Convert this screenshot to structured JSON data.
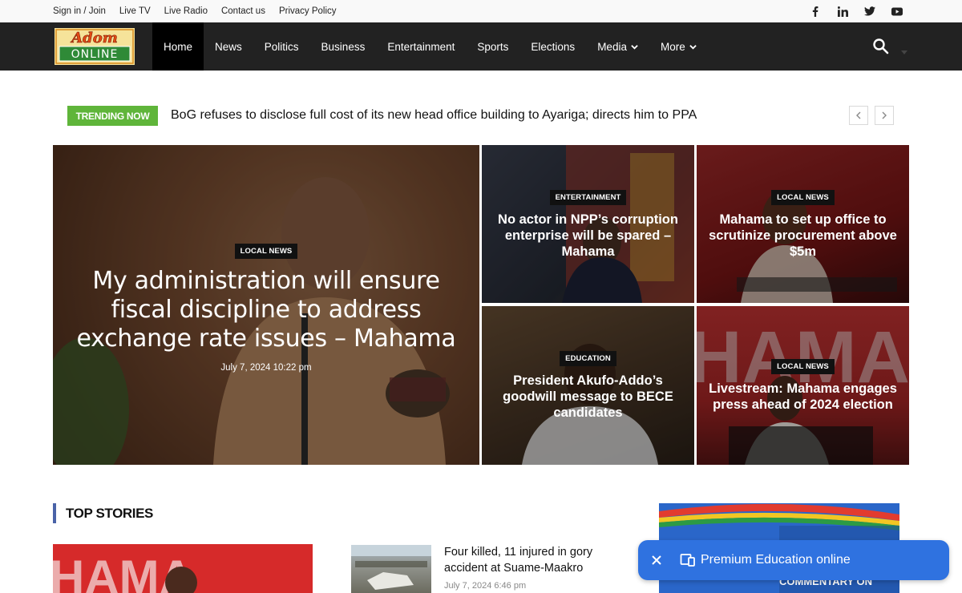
{
  "topbar": {
    "links": [
      "Sign in / Join",
      "Live TV",
      "Live Radio",
      "Contact us",
      "Privacy Policy"
    ],
    "social_icons": [
      "facebook-icon",
      "linkedin-icon",
      "twitter-icon",
      "youtube-icon"
    ]
  },
  "logo": {
    "top_text": "Adom",
    "bottom_text": "ONLINE"
  },
  "nav": {
    "items": [
      "Home",
      "News",
      "Politics",
      "Business",
      "Entertainment",
      "Sports",
      "Elections",
      "Media",
      "More"
    ],
    "active": "Home",
    "dropdown_items": [
      "Media",
      "More"
    ]
  },
  "trending": {
    "label": "TRENDING NOW",
    "headline": "BoG refuses to disclose full cost of its new head office building to Ayariga; directs him to PPA"
  },
  "hero": {
    "main": {
      "category": "LOCAL NEWS",
      "title": "My administration will ensure fiscal discipline to address exchange rate issues – Mahama",
      "date": "July 7, 2024 10:22 pm"
    },
    "tiles": [
      {
        "category": "ENTERTAINMENT",
        "title": "No actor in NPP’s corruption enterprise will be spared – Mahama"
      },
      {
        "category": "LOCAL NEWS",
        "title": "Mahama to set up office to scrutinize procurement above $5m"
      },
      {
        "category": "EDUCATION",
        "title": "President Akufo-Addo’s goodwill message to BECE candidates"
      },
      {
        "category": "LOCAL NEWS",
        "title": "Livestream: Mahama engages press ahead of 2024 election"
      }
    ]
  },
  "top_stories": {
    "heading": "TOP STORIES",
    "story": {
      "title": "Four killed, 11 injured in gory accident at Suame-Maakro",
      "date": "July 7, 2024 6:46 pm"
    }
  },
  "ad": {
    "text": "COMMENTARY ON"
  },
  "popup": {
    "label": "Premium Education online"
  },
  "colors": {
    "accent_green": "#5fb53a",
    "nav_bg": "#222222",
    "popup_blue": "#2f72e0",
    "section_bar": "#4a63a8"
  }
}
